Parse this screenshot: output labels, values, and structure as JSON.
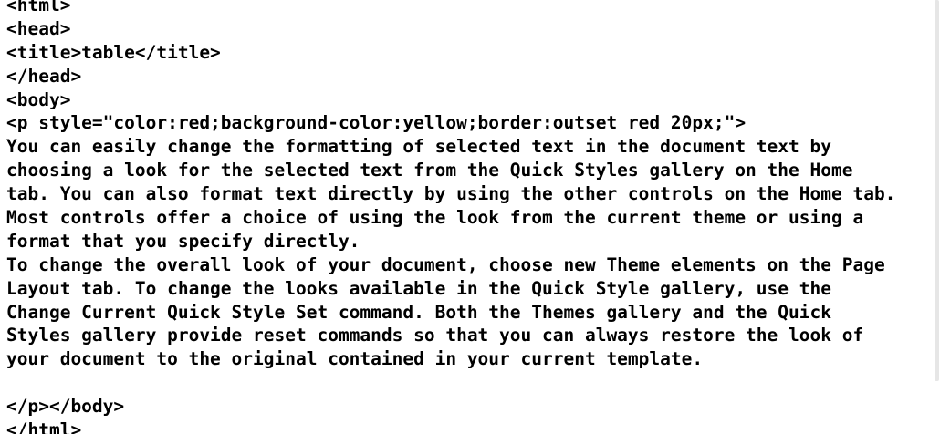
{
  "editor": {
    "lines": [
      "<html>",
      "<head>",
      "<title>table</title>",
      "</head>",
      "<body>",
      "<p style=\"color:red;background-color:yellow;border:outset red 20px;\">",
      "You can easily change the formatting of selected text in the document text by",
      "choosing a look for the selected text from the Quick Styles gallery on the Home",
      "tab. You can also format text directly by using the other controls on the Home tab.",
      "Most controls offer a choice of using the look from the current theme or using a",
      "format that you specify directly.",
      "To change the overall look of your document, choose new Theme elements on the Page",
      "Layout tab. To change the looks available in the Quick Style gallery, use the",
      "Change Current Quick Style Set command. Both the Themes gallery and the Quick",
      "Styles gallery provide reset commands so that you can always restore the look of",
      "your document to the original contained in your current template.",
      "",
      "</p></body>",
      "</html>"
    ]
  }
}
